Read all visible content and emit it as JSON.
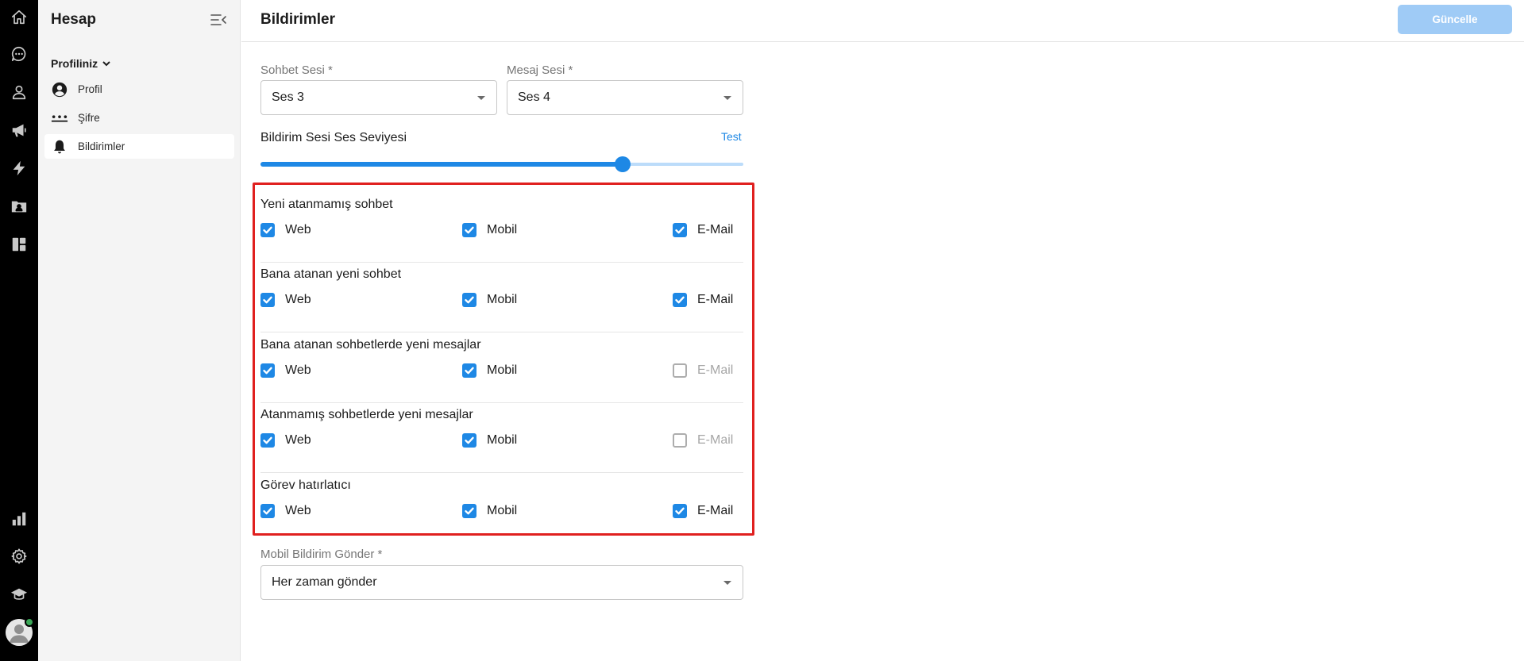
{
  "rail": {
    "top_icons": [
      "home-icon",
      "chat-icon",
      "contacts-icon",
      "megaphone-icon",
      "lightning-icon",
      "contact-folder-icon",
      "dashboard-icon"
    ],
    "bottom_icons": [
      "reports-icon",
      "settings-icon",
      "academy-icon"
    ],
    "status_color": "#3aa757"
  },
  "sidebar": {
    "title": "Hesap",
    "group_label": "Profiliniz",
    "items": [
      {
        "label": "Profil",
        "icon": "account-circle-icon",
        "active": false
      },
      {
        "label": "Şifre",
        "icon": "password-dots-icon",
        "active": false
      },
      {
        "label": "Bildirimler",
        "icon": "bell-icon",
        "active": true
      }
    ]
  },
  "header": {
    "title": "Bildirimler",
    "update_button": "Güncelle"
  },
  "form": {
    "chat_sound": {
      "label": "Sohbet Sesi *",
      "value": "Ses 3"
    },
    "message_sound": {
      "label": "Mesaj Sesi *",
      "value": "Ses 4"
    },
    "volume": {
      "label": "Bildirim Sesi Ses Seviyesi",
      "test_label": "Test",
      "level_percent": 75
    },
    "groups": [
      {
        "title": "Yeni atanmamış sohbet",
        "options": [
          {
            "label": "Web",
            "checked": true,
            "disabled": false
          },
          {
            "label": "Mobil",
            "checked": true,
            "disabled": false
          },
          {
            "label": "E-Mail",
            "checked": true,
            "disabled": false
          }
        ]
      },
      {
        "title": "Bana atanan yeni sohbet",
        "options": [
          {
            "label": "Web",
            "checked": true,
            "disabled": false
          },
          {
            "label": "Mobil",
            "checked": true,
            "disabled": false
          },
          {
            "label": "E-Mail",
            "checked": true,
            "disabled": false
          }
        ]
      },
      {
        "title": "Bana atanan sohbetlerde yeni mesajlar",
        "options": [
          {
            "label": "Web",
            "checked": true,
            "disabled": false
          },
          {
            "label": "Mobil",
            "checked": true,
            "disabled": false
          },
          {
            "label": "E-Mail",
            "checked": false,
            "disabled": true
          }
        ]
      },
      {
        "title": "Atanmamış sohbetlerde yeni mesajlar",
        "options": [
          {
            "label": "Web",
            "checked": true,
            "disabled": false
          },
          {
            "label": "Mobil",
            "checked": true,
            "disabled": false
          },
          {
            "label": "E-Mail",
            "checked": false,
            "disabled": true
          }
        ]
      },
      {
        "title": "Görev hatırlatıcı",
        "options": [
          {
            "label": "Web",
            "checked": true,
            "disabled": false
          },
          {
            "label": "Mobil",
            "checked": true,
            "disabled": false
          },
          {
            "label": "E-Mail",
            "checked": true,
            "disabled": false
          }
        ]
      }
    ],
    "mobile_push": {
      "label": "Mobil Bildirim Gönder *",
      "value": "Her zaman gönder"
    }
  },
  "colors": {
    "accent": "#1e88e5",
    "highlight": "#e0201f",
    "button_disabled": "#9fcbf6"
  }
}
